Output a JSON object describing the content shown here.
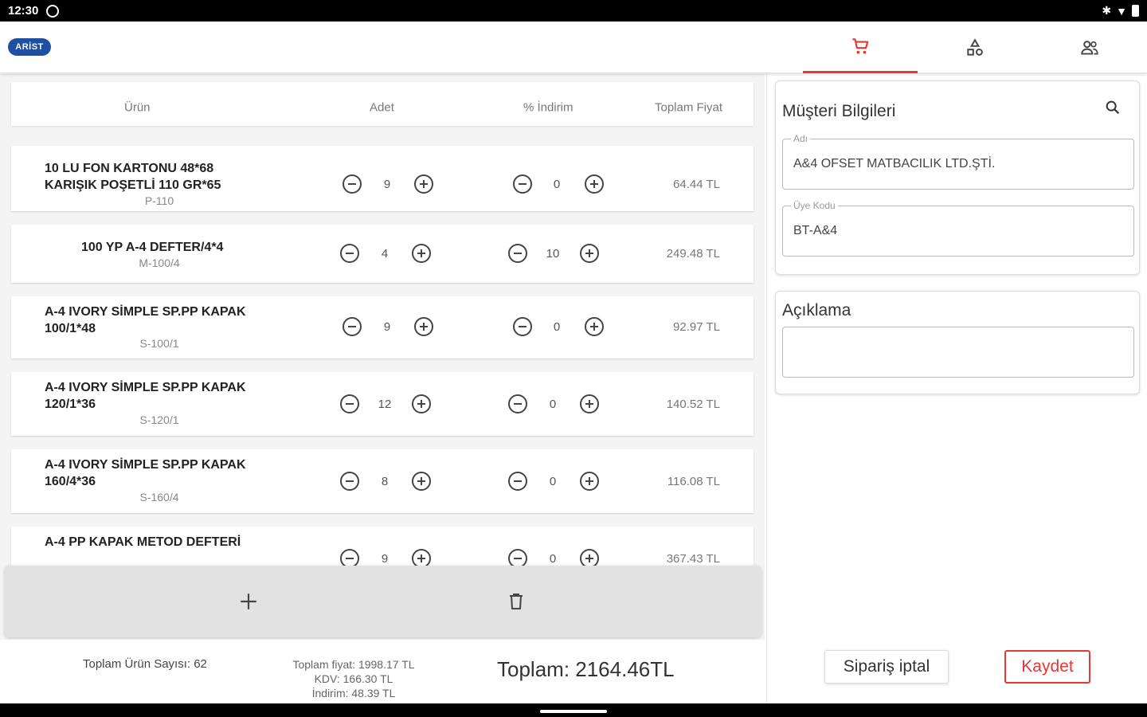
{
  "status_bar": {
    "time": "12:30"
  },
  "app_bar": {
    "logo_text": "ARİST",
    "tabs": [
      {
        "icon": "cart-icon",
        "active": true
      },
      {
        "icon": "shapes-icon",
        "active": false
      },
      {
        "icon": "users-icon",
        "active": false
      }
    ],
    "accent_color": "#e53935"
  },
  "table": {
    "headers": {
      "product": "Ürün",
      "quantity": "Adet",
      "discount": "% İndirim",
      "total_price": "Toplam Fiyat"
    },
    "rows": [
      {
        "name": "10 LU FON KARTONU 48*68 KARIŞIK POŞETLİ 110 GR*65",
        "code": "P-110",
        "quantity": "9",
        "discount": "0",
        "price": "64.44 TL"
      },
      {
        "name": "100 YP A-4 DEFTER/4*4",
        "code": "M-100/4",
        "quantity": "4",
        "discount": "10",
        "price": "249.48 TL"
      },
      {
        "name": "A-4 IVORY SİMPLE SP.PP KAPAK 100/1*48",
        "code": "S-100/1",
        "quantity": "9",
        "discount": "0",
        "price": "92.97 TL"
      },
      {
        "name": "A-4 IVORY SİMPLE SP.PP KAPAK 120/1*36",
        "code": "S-120/1",
        "quantity": "12",
        "discount": "0",
        "price": "140.52 TL"
      },
      {
        "name": "A-4 IVORY SİMPLE SP.PP KAPAK 160/4*36",
        "code": "S-160/4",
        "quantity": "8",
        "discount": "0",
        "price": "116.08 TL"
      },
      {
        "name": "A-4 PP KAPAK METOD DEFTERİ",
        "code": "",
        "quantity": "9",
        "discount": "0",
        "price": "367.43 TL"
      }
    ]
  },
  "summary": {
    "product_count": "Toplam Ürün Sayısı: 62",
    "total_price": "Toplam fiyat: 1998.17 TL",
    "kdv": "KDV: 166.30 TL",
    "discount": "İndirim: 48.39 TL",
    "grand_total": "Toplam: 2164.46TL"
  },
  "customer": {
    "title": "Müşteri Bilgileri",
    "name_label": "Adı",
    "name_value": "A&4 OFSET MATBACILIK LTD.ŞTİ.",
    "code_label": "Üye Kodu",
    "code_value": "BT-A&4"
  },
  "description": {
    "title": "Açıklama",
    "value": ""
  },
  "buttons": {
    "cancel": "Sipariş iptal",
    "save": "Kaydet"
  }
}
